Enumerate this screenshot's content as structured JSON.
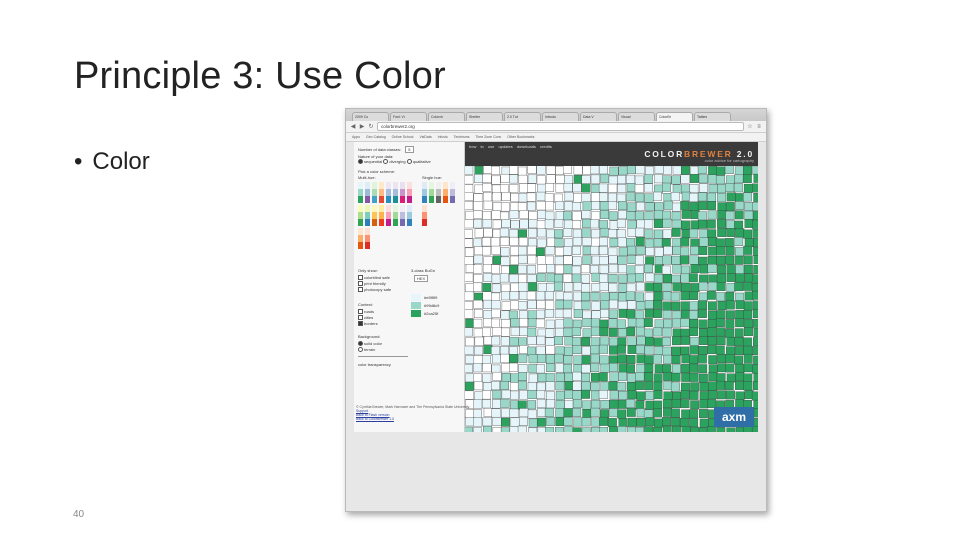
{
  "slide": {
    "title": "Principle 3: Use Color",
    "bullets": [
      "Color"
    ],
    "slide_number": "40"
  },
  "browser": {
    "tabs": [
      "2009 Co",
      "Fwd: Vi",
      "Colorch",
      "Shelter",
      "2.0 Tut",
      "Introdu",
      "Data V",
      "Visual",
      "ColorBr",
      "Tables"
    ],
    "url": "colorbrewer2.org",
    "bookmarks": [
      "Apps",
      "Geo Catalog",
      "Online School",
      "VisData",
      "Infovis",
      "Techrisms",
      "Time Zone Conv",
      "Other Bookmarks"
    ]
  },
  "colorbrewer": {
    "sidebar": {
      "data_classes_label": "Number of data classes:",
      "data_classes_value": "5",
      "nature_label": "Nature of your data:",
      "nature_options": [
        "sequential",
        "diverging",
        "qualitative"
      ],
      "scheme_label": "Pick a color scheme:",
      "multihue_label": "Multi-hue:",
      "singlehue_label": "Single hue:",
      "only_show_label": "Only show:",
      "only_show_options": [
        "colorblind safe",
        "print friendly",
        "photocopy safe"
      ],
      "classes_title": "3-class BuGn",
      "export_value": "HEX",
      "hex_values": [
        "#e5f5f9",
        "#99d8c9",
        "#2ca25f"
      ],
      "context_label": "Context:",
      "context_options": [
        "roads",
        "cities",
        "borders"
      ],
      "background_label": "Background:",
      "background_options": [
        "solid color",
        "terrain"
      ],
      "transparency_label": "color transparency"
    },
    "topnav": "how to use   updates   downloads   credits",
    "logo_main": "COLOR",
    "logo_accent": "BREWER",
    "logo_version": " 2.0",
    "logo_tagline": "color advice for cartography",
    "footer_text": "© Cynthia Brewer, Mark Harrower and The Pennsylvania State University",
    "footer_links": [
      "Support",
      "Back to Flash version",
      "Back to ColorBrewer 1.0"
    ],
    "sponsor": "axm",
    "colors": {
      "light": "#e5f5f9",
      "mid": "#99d8c9",
      "dark": "#2ca25f"
    }
  }
}
